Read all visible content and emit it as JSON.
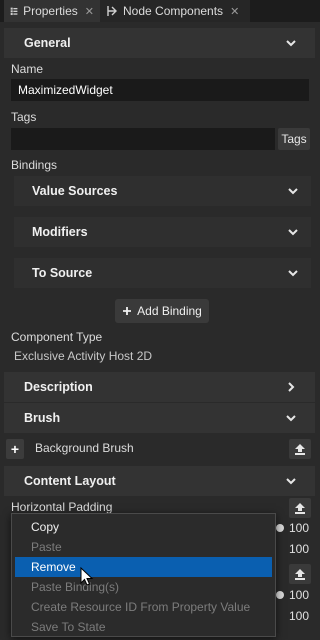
{
  "tabs": [
    {
      "label": "Properties",
      "close": "✕"
    },
    {
      "label": "Node Components",
      "close": "✕"
    }
  ],
  "sections": {
    "general": "General",
    "description": "Description",
    "brush": "Brush",
    "content_layout": "Content Layout"
  },
  "fields": {
    "name_label": "Name",
    "name_value": "MaximizedWidget",
    "tags_label": "Tags",
    "tags_button": "Tags",
    "bindings_label": "Bindings",
    "component_type_label": "Component Type",
    "component_type_value": "Exclusive Activity Host 2D"
  },
  "bindings": {
    "value_sources": "Value Sources",
    "modifiers": "Modifiers",
    "to_source": "To Source",
    "add_binding": "Add Binding"
  },
  "brush": {
    "plus": "+",
    "background_brush": "Background Brush"
  },
  "content_layout": {
    "horizontal_padding_label": "Horizontal Padding",
    "values": [
      "100",
      "100",
      "100",
      "100"
    ]
  },
  "context_menu": {
    "items": [
      {
        "label": "Copy",
        "enabled": true
      },
      {
        "label": "Paste",
        "enabled": false
      },
      {
        "label": "Remove",
        "enabled": true,
        "highlighted": true
      },
      {
        "label": "Paste Binding(s)",
        "enabled": false
      },
      {
        "label": "Create Resource ID From Property Value",
        "enabled": false
      },
      {
        "label": "Save To State",
        "enabled": false
      }
    ]
  },
  "colors": {
    "background": "#242424",
    "section": "#333333",
    "menu_highlight": "#0a5fb0"
  }
}
